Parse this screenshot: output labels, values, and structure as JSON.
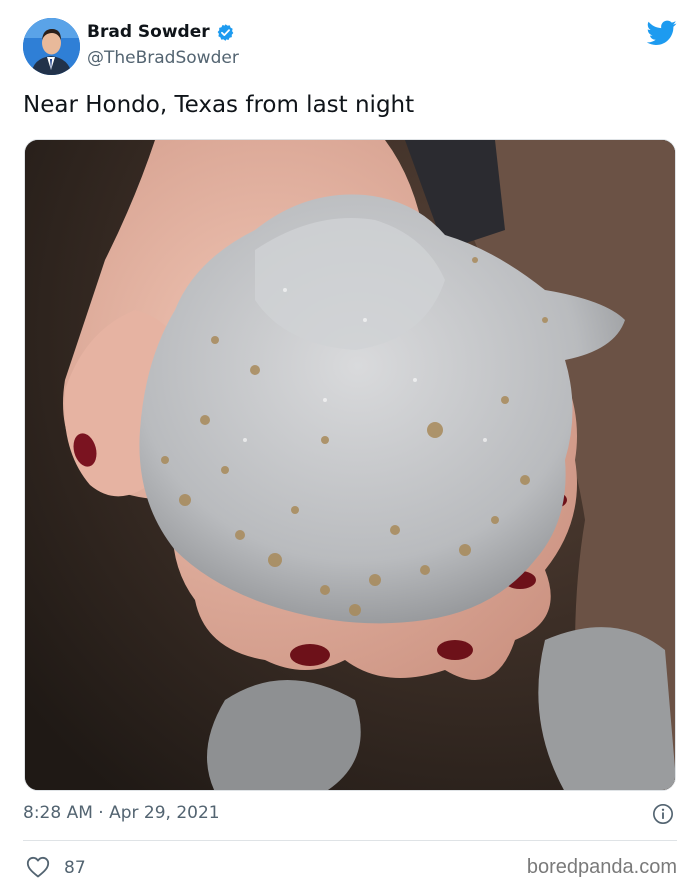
{
  "author": {
    "display_name": "Brad Sowder",
    "handle": "@TheBradSowder",
    "verified": true
  },
  "tweet": {
    "text": "Near Hondo, Texas from last night",
    "timestamp": "8:28 AM · Apr 29, 2021",
    "like_count": "87"
  },
  "media": {
    "description_icon": "photo"
  },
  "icons": {
    "bird": "twitter-bird-icon",
    "verified": "verified-badge-icon",
    "info": "info-icon",
    "like": "heart-icon"
  },
  "colors": {
    "twitter_blue": "#1d9bf0",
    "text_primary": "#0f1419",
    "text_secondary": "#536471"
  },
  "watermark": "boredpanda.com"
}
